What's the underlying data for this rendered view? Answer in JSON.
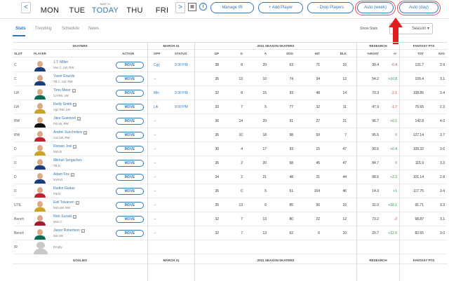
{
  "header": {
    "nav_prev": "<",
    "nav_next": ">",
    "days": [
      {
        "name": "MON",
        "date": ""
      },
      {
        "name": "TUE",
        "date": ""
      },
      {
        "name": "TODAY",
        "date": "MAR 31"
      },
      {
        "name": "THU",
        "date": ""
      },
      {
        "name": "FRI",
        "date": ""
      }
    ],
    "buttons": {
      "manage_ir": "Manage IR",
      "add_player": "+ Add Player",
      "drop_players": "- Drop Players",
      "auto_week": "Auto (week)",
      "auto_day": "Auto (day)"
    },
    "calendar_glyph": "▦",
    "info_glyph": "i"
  },
  "tabs": [
    "Stats",
    "Trending",
    "Schedule",
    "News"
  ],
  "show_stats_label": "Show Stats",
  "season_select": "Season",
  "group_headers": {
    "skaters": "SKATERS",
    "date": "MARCH 31",
    "season": "2021 SEASON SKATERS",
    "research": "RESEARCH",
    "fantasy": "FANTASY PTS"
  },
  "columns": {
    "slot": "SLOT",
    "player": "PLAYER",
    "action": "ACTION",
    "opp": "OPP",
    "status": "STATUS",
    "gp": "GP",
    "g": "G",
    "a": "A",
    "sog": "SOG",
    "hit": "HIT",
    "blk": "BLK",
    "rost": "%ROST",
    "pm": "+/-",
    "tot": "TOT",
    "avg": "AVG"
  },
  "move_label": "MOVE",
  "players": [
    {
      "slot": "C",
      "name": "J.T. Miller",
      "meta": "Van C, LW, RW",
      "opp": "Cgy",
      "status": "9:30 PM",
      "gp": "38",
      "g": "8",
      "a": "20",
      "sog": "63",
      "hit": "71",
      "blk": "16",
      "rost": "99.4",
      "pm": "-0.4",
      "pmc": "neg",
      "tot": "131.7",
      "avg": "3.9",
      "news": false
    },
    {
      "slot": "C",
      "name": "Yanni Gourde",
      "meta": "TB C, LW, RW",
      "opp": "--",
      "status": "",
      "gp": "35",
      "g": "13",
      "a": "10",
      "sog": "74",
      "hit": "34",
      "blk": "13",
      "rost": "54.2",
      "pm": "+10.8",
      "pmc": "pos",
      "tot": "109.4",
      "avg": "3.1",
      "news": false
    },
    {
      "slot": "LW",
      "name": "Timo Meier",
      "meta": "SJ RW, LW",
      "opp": "Min",
      "status": "9:30 PM",
      "gp": "32",
      "g": "8",
      "a": "15",
      "sog": "93",
      "hit": "48",
      "blk": "14",
      "rost": "70.3",
      "pm": "-2.1",
      "pmc": "neg",
      "tot": "108.85",
      "avg": "3.4",
      "news": true
    },
    {
      "slot": "LW",
      "name": "Reilly Smith",
      "meta": "Vgs RW, LW",
      "opp": "LA",
      "status": "9:00 PM",
      "gp": "33",
      "g": "7",
      "a": "5",
      "sog": "77",
      "hit": "32",
      "blk": "11",
      "rost": "47.9",
      "pm": "-1.7",
      "pmc": "neg",
      "tot": "76.65",
      "avg": "2.3",
      "news": true
    },
    {
      "slot": "RW",
      "name": "Jake Guentzel",
      "meta": "Pit LW, RW",
      "opp": "--",
      "status": "",
      "gp": "36",
      "g": "14",
      "a": "20",
      "sog": "91",
      "hit": "27",
      "blk": "21",
      "rost": "96.7",
      "pm": "+0.1",
      "pmc": "pos",
      "tot": "142.8",
      "avg": "4.0",
      "news": true
    },
    {
      "slot": "RW",
      "name": "Andrei Svechnikov",
      "meta": "Car LW, RW",
      "opp": "--",
      "status": "",
      "gp": "35",
      "g": "10",
      "a": "18",
      "sog": "98",
      "hit": "59",
      "blk": "7",
      "rost": "95.5",
      "pm": "0",
      "pmc": "muted",
      "tot": "127.14",
      "avg": "3.7",
      "news": true
    },
    {
      "slot": "D",
      "name": "Roman Josi",
      "meta": "Nsh D",
      "opp": "--",
      "status": "",
      "gp": "30",
      "g": "4",
      "a": "17",
      "sog": "93",
      "hit": "15",
      "blk": "47",
      "rost": "90.6",
      "pm": "+0.4",
      "pmc": "pos",
      "tot": "109.32",
      "avg": "3.6",
      "news": true
    },
    {
      "slot": "D",
      "name": "Mikhail Sergachev",
      "meta": "TB D",
      "opp": "--",
      "status": "",
      "gp": "35",
      "g": "2",
      "a": "20",
      "sog": "68",
      "hit": "45",
      "blk": "47",
      "rost": "84.7",
      "pm": "0",
      "pmc": "muted",
      "tot": "115.9",
      "avg": "3.3",
      "news": false
    },
    {
      "slot": "D",
      "name": "Adam Fox",
      "meta": "NYR D",
      "opp": "--",
      "status": "",
      "gp": "34",
      "g": "2",
      "a": "21",
      "sog": "48",
      "hit": "21",
      "blk": "44",
      "rost": "98.6",
      "pm": "+2.2",
      "pmc": "pos",
      "tot": "101.14",
      "avg": "2.8",
      "news": true
    },
    {
      "slot": "D",
      "name": "Radko Gudas",
      "meta": "Fla D",
      "opp": "--",
      "status": "",
      "gp": "35",
      "g": "0",
      "a": "5",
      "sog": "51",
      "hit": "164",
      "blk": "46",
      "rost": "14.3",
      "pm": "+1",
      "pmc": "pos",
      "tot": "117.75",
      "avg": "3.4",
      "news": false
    },
    {
      "slot": "UTIL",
      "name": "Eeli Tolvanen",
      "meta": "Nsh LW, RW",
      "opp": "--",
      "status": "",
      "gp": "35",
      "g": "13",
      "a": "6",
      "sog": "85",
      "hit": "56",
      "blk": "16",
      "rost": "31.0",
      "pm": "+18.1",
      "pmc": "pos",
      "tot": "91.71",
      "avg": "3.3",
      "news": true
    },
    {
      "slot": "Bench",
      "name": "Nick Suzuki",
      "meta": "Mon C",
      "opp": "--",
      "status": "",
      "gp": "32",
      "g": "7",
      "a": "13",
      "sog": "80",
      "hit": "22",
      "blk": "12",
      "rost": "73.2",
      "pm": "-2",
      "pmc": "neg",
      "tot": "98.87",
      "avg": "3.1",
      "news": true
    },
    {
      "slot": "Bench",
      "name": "Jason Robertson",
      "meta": "Dal LW",
      "opp": "--",
      "status": "",
      "gp": "32",
      "g": "7",
      "a": "13",
      "sog": "62",
      "hit": "6",
      "blk": "10",
      "rost": "20.7",
      "pm": "+12.5",
      "pmc": "pos",
      "tot": "82.65",
      "avg": "3.0",
      "news": true
    },
    {
      "slot": "IR",
      "name": "Empty",
      "meta": "",
      "opp": "",
      "status": "",
      "gp": "",
      "g": "",
      "a": "",
      "sog": "",
      "hit": "",
      "blk": "",
      "rost": "",
      "pm": "",
      "pmc": "muted",
      "tot": "",
      "avg": "",
      "news": false,
      "empty": true
    }
  ],
  "goalies_headers": {
    "goalies": "GOALIES",
    "date": "MARCH 31",
    "season": "2021 SEASON SKATERS",
    "research": "RESEARCH",
    "fantasy": "FANTASY PTS"
  },
  "colors": {
    "accent": "#3477b5",
    "positive": "#1c9a3b",
    "negative": "#d23a3a",
    "callout": "#e02020"
  }
}
